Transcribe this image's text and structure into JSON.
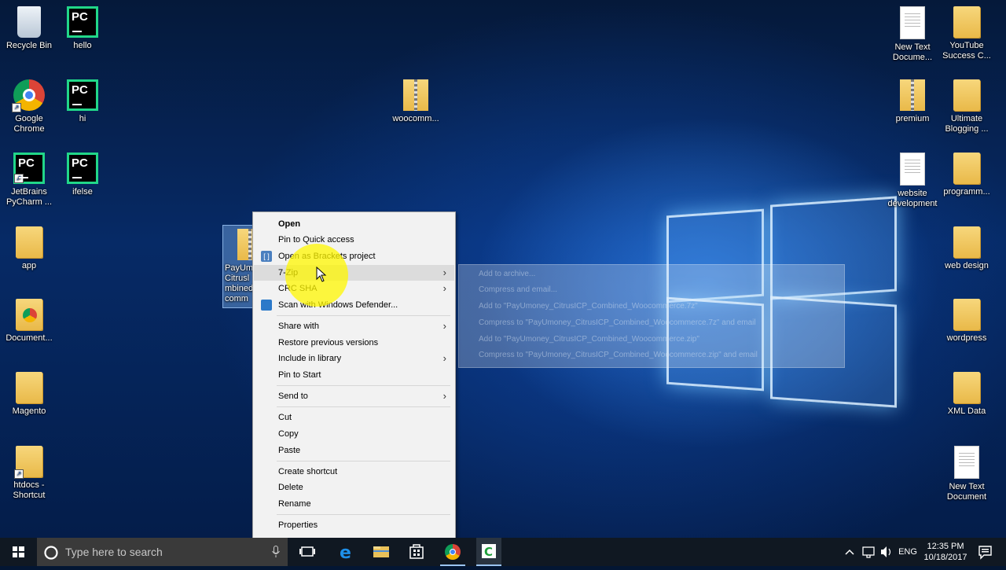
{
  "desktop_icons": {
    "recycle_bin": "Recycle Bin",
    "hello": "hello",
    "hi": "hi",
    "ifelse": "ifelse",
    "chrome": "Google Chrome",
    "pycharm": "JetBrains PyCharm ...",
    "app": "app",
    "documents": "Document...",
    "magento": "Magento",
    "htdocs": "htdocs - Shortcut",
    "payumoney": "PayUm Citrusl mbined comm",
    "woocommerce": "woocomm...",
    "new_text_doc_1": "New Text Docume...",
    "youtube": "YouTube Success C...",
    "premium": "premium",
    "ultimate": "Ultimate Blogging ...",
    "website_dev": "website development",
    "programming": "programm...",
    "web_design": "web design",
    "wordpress": "wordpress",
    "xml_data": "XML Data",
    "new_text_doc_2": "New Text Document"
  },
  "context_menu": {
    "open": "Open",
    "pin_quick": "Pin to Quick access",
    "open_brackets": "Open as Brackets project",
    "seven_zip": "7-Zip",
    "crc_sha": "CRC SHA",
    "scan_defender": "Scan with Windows Defender...",
    "share_with": "Share with",
    "restore": "Restore previous versions",
    "include_library": "Include in library",
    "pin_start": "Pin to Start",
    "send_to": "Send to",
    "cut": "Cut",
    "copy": "Copy",
    "paste": "Paste",
    "create_shortcut": "Create shortcut",
    "delete": "Delete",
    "rename": "Rename",
    "properties": "Properties"
  },
  "submenu": {
    "add_archive": "Add to archive...",
    "compress_email": "Compress and email...",
    "add_7z": "Add to \"PayUmoney_CitrusICP_Combined_Woocommerce.7z\"",
    "compress_7z_email": "Compress to \"PayUmoney_CitrusICP_Combined_Woocommerce.7z\" and email",
    "add_zip": "Add to \"PayUmoney_CitrusICP_Combined_Woocommerce.zip\"",
    "compress_zip_email": "Compress to \"PayUmoney_CitrusICP_Combined_Woocommerce.zip\" and email"
  },
  "taskbar": {
    "search_placeholder": "Type here to search",
    "language": "ENG",
    "time": "12:35 PM",
    "date": "10/18/2017"
  }
}
